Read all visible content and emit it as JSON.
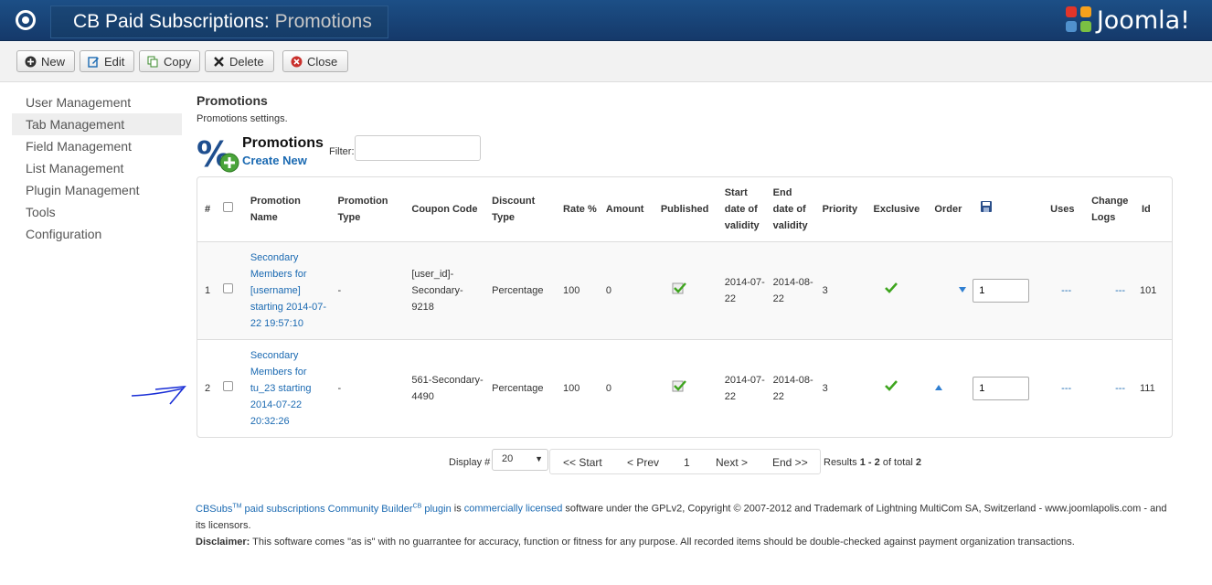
{
  "header": {
    "title": "CB Paid Subscriptions:",
    "subtitle": "Promotions",
    "brand": "Joomla!"
  },
  "toolbar": {
    "buttons": [
      {
        "label": "New",
        "icon": "plus-circle-icon"
      },
      {
        "label": "Edit",
        "icon": "edit-icon"
      },
      {
        "label": "Copy",
        "icon": "copy-icon"
      },
      {
        "label": "Delete",
        "icon": "x-icon"
      },
      {
        "label": "Close",
        "icon": "close-circle-icon"
      }
    ]
  },
  "sidebar": {
    "items": [
      {
        "label": "User Management"
      },
      {
        "label": "Tab Management",
        "active": true
      },
      {
        "label": "Field Management"
      },
      {
        "label": "List Management"
      },
      {
        "label": "Plugin Management"
      },
      {
        "label": "Tools"
      },
      {
        "label": "Configuration"
      }
    ]
  },
  "main": {
    "heading": "Promotions",
    "subheading": "Promotions settings.",
    "list_title": "Promotions",
    "create_new": "Create New",
    "filter_label": "Filter:",
    "filter_value": ""
  },
  "table": {
    "headers": {
      "num": "#",
      "promotion_name": "Promotion Name",
      "promotion_type": "Promotion Type",
      "coupon_code": "Coupon Code",
      "discount_type": "Discount Type",
      "rate": "Rate %",
      "amount": "Amount",
      "published": "Published",
      "start_date": "Start date of validity",
      "end_date": "End date of validity",
      "priority": "Priority",
      "exclusive": "Exclusive",
      "order": "Order",
      "uses": "Uses",
      "change_logs": "Change Logs",
      "id": "Id"
    },
    "rows": [
      {
        "num": "1",
        "name": "Secondary Members for [username] starting 2014-07-22 19:57:10",
        "type": "-",
        "coupon": "[user_id]-Secondary-9218",
        "discount_type": "Percentage",
        "rate": "100",
        "amount": "0",
        "start": "2014-07-22",
        "end": "2014-08-22",
        "priority": "3",
        "order_value": "1",
        "uses": "---",
        "logs": "---",
        "id": "101",
        "order_arrow": "down"
      },
      {
        "num": "2",
        "name": "Secondary Members for tu_23 starting 2014-07-22 20:32:26",
        "type": "-",
        "coupon": "561-Secondary-4490",
        "discount_type": "Percentage",
        "rate": "100",
        "amount": "0",
        "start": "2014-07-22",
        "end": "2014-08-22",
        "priority": "3",
        "order_value": "1",
        "uses": "---",
        "logs": "---",
        "id": "111",
        "order_arrow": "up"
      }
    ]
  },
  "pagination": {
    "display_label": "Display #",
    "display_value": "20",
    "start": "<< Start",
    "prev": "< Prev",
    "page": "1",
    "next": "Next >",
    "end": "End >>",
    "results_prefix": "Results ",
    "results_range": "1 - 2",
    "results_mid": " of total ",
    "results_total": "2"
  },
  "footer": {
    "cbsubs": "CBSubs",
    "tm": "TM",
    "paid_subs": " paid subscriptions Community Builder",
    "cb": "CB",
    "plugin": " plugin",
    "is": " is ",
    "licensed": "commercially licensed",
    "rest": " software under the GPLv2, Copyright © 2007-2012 and Trademark of Lightning MultiCom SA, Switzerland - www.joomlapolis.com - and its licensors.",
    "disclaimer_label": "Disclaimer:",
    "disclaimer_text": " This software comes \"as is\" with no guarrantee for accuracy, function or fitness for any purpose. All recorded items should be double-checked against payment organization transactions."
  },
  "colors": {
    "header_bg": "#1c4f86",
    "link": "#1b6ab2",
    "check": "#3ea51e"
  }
}
